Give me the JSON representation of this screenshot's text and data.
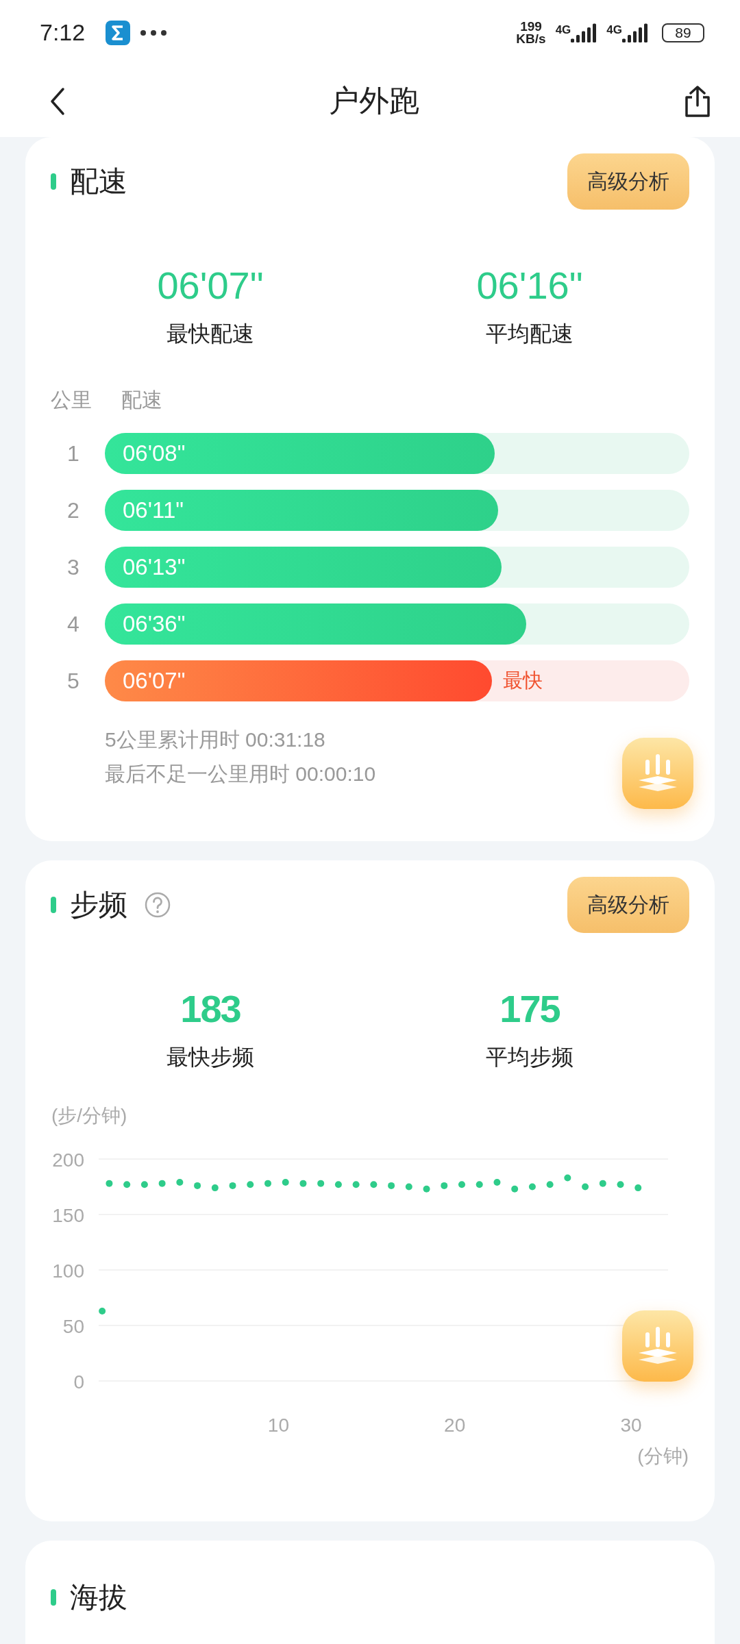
{
  "status_bar": {
    "time": "7:12",
    "net_speed": [
      "199",
      "KB/s"
    ],
    "network": [
      "4G",
      "4G"
    ],
    "battery": "89"
  },
  "header": {
    "title": "户外跑"
  },
  "pace": {
    "title": "配速",
    "button": "高级分析",
    "stats": [
      {
        "value": "06'07\"",
        "label": "最快配速"
      },
      {
        "value": "06'16\"",
        "label": "平均配速"
      }
    ],
    "columns": [
      "公里",
      "配速"
    ],
    "splits": [
      {
        "km": "1",
        "pace": "06'08\"",
        "level": 0.667,
        "fastest": false
      },
      {
        "km": "2",
        "pace": "06'11\"",
        "level": 0.673,
        "fastest": false
      },
      {
        "km": "3",
        "pace": "06'13\"",
        "level": 0.679,
        "fastest": false
      },
      {
        "km": "4",
        "pace": "06'36\"",
        "level": 0.721,
        "fastest": false
      },
      {
        "km": "5",
        "pace": "06'07\"",
        "level": 0.662,
        "fastest": true,
        "badge": "最快"
      }
    ],
    "summary": [
      "5公里累计用时 00:31:18",
      "最后不足一公里用时 00:00:10"
    ]
  },
  "cadence": {
    "title": "步频",
    "button": "高级分析",
    "stats": [
      {
        "value": "183",
        "label": "最快步频"
      },
      {
        "value": "175",
        "label": "平均步频"
      }
    ],
    "chart_data": {
      "type": "scatter",
      "grid": true,
      "xlabel": "(分钟)",
      "ylabel": "(步/分钟)",
      "xlim": [
        -0.2,
        32.1
      ],
      "ylim": [
        0,
        200
      ],
      "xticks": [
        10,
        20,
        30
      ],
      "yticks": [
        0,
        50,
        100,
        150,
        200
      ],
      "x": [
        0,
        0.4,
        1.4,
        2.4,
        3.4,
        4.4,
        5.4,
        6.4,
        7.4,
        8.4,
        9.4,
        10.4,
        11.4,
        12.4,
        13.4,
        14.4,
        15.4,
        16.4,
        17.4,
        18.4,
        19.4,
        20.4,
        21.4,
        22.4,
        23.4,
        24.4,
        25.4,
        26.4,
        27.4,
        28.4,
        29.4,
        30.4
      ],
      "values": [
        63,
        178,
        177,
        177,
        178,
        179,
        176,
        174,
        176,
        177,
        178,
        179,
        178,
        178,
        177,
        177,
        177,
        176,
        175,
        173,
        176,
        177,
        177,
        179,
        173,
        175,
        177,
        183,
        175,
        178,
        177,
        174
      ]
    }
  },
  "altitude": {
    "title": "海拔"
  }
}
